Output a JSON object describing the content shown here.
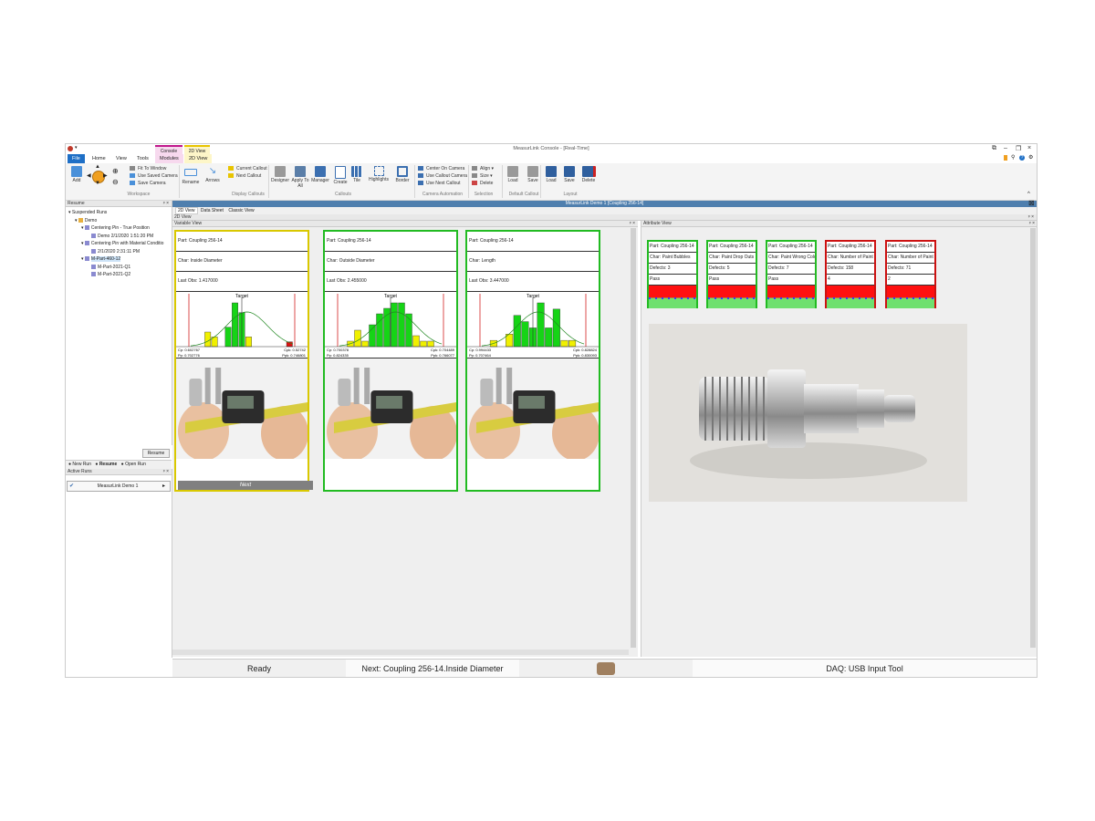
{
  "app": {
    "title": "MeasurLink Console - [Real-Time]",
    "context_tabs": [
      {
        "label": "Console",
        "color": "#c0188c"
      },
      {
        "label": "2D View",
        "color": "#e8c400"
      }
    ],
    "menu_tabs": [
      "File",
      "Home",
      "View",
      "Tools",
      "Modules",
      "2D View"
    ],
    "active_tab": "2D View"
  },
  "ribbon": {
    "workspace": {
      "group_label": "Workspace",
      "add_label": "Add",
      "small_items": [
        "Fit To Window",
        "Use Saved Camera",
        "Save Camera"
      ]
    },
    "display_callouts": {
      "group_label": "Display Callouts",
      "buttons": [
        "Rename",
        "Arrows"
      ],
      "small_items": [
        "Current Callout",
        "Next Callout"
      ]
    },
    "callouts": {
      "group_label": "Callouts",
      "buttons": [
        "Designer",
        "Apply To All",
        "Manager",
        "Create",
        "Tile",
        "Highlights",
        "Border"
      ]
    },
    "camera_automation": {
      "group_label": "Camera Automation",
      "small_items": [
        "Center On Camera",
        "Use Callout Camera",
        "Use Next Callout"
      ]
    },
    "selection": {
      "group_label": "Selection",
      "small_items": [
        "Align",
        "Size",
        "Delete"
      ]
    },
    "default_callout": {
      "group_label": "Default Callout",
      "buttons": [
        "Load",
        "Save"
      ]
    },
    "layout": {
      "group_label": "Layout",
      "buttons": [
        "Load",
        "Save",
        "Delete"
      ]
    }
  },
  "resume_pane": {
    "title": "Resume",
    "tree": [
      {
        "label": "Suspended Runs",
        "level": 0
      },
      {
        "label": "Demo",
        "level": 1
      },
      {
        "label": "Centering Pin - True Position",
        "level": 2
      },
      {
        "label": "Demo 2/1/2020 1:51:20 PM",
        "level": 3
      },
      {
        "label": "Centering Pin with Material Conditio",
        "level": 2
      },
      {
        "label": "2/1/2020 2:31:11 PM",
        "level": 3
      },
      {
        "label": "M-Part-460-12",
        "level": 1
      },
      {
        "label": "M-Part-2021-Q1",
        "level": 2
      },
      {
        "label": "M-Part-2021-Q2",
        "level": 2
      }
    ],
    "resume_button": "Resume",
    "bottom_tabs": [
      "New Run",
      "Resume",
      "Open Run"
    ],
    "active_runs_title": "Active Runs",
    "active_run": "MeasurLink Demo 1"
  },
  "document_tab": "MeasurLink Demo 1 [Coupling 256-14]",
  "view_tabs": [
    "2D View",
    "Data Sheet",
    "Classic View"
  ],
  "pane_2d_title": "2D View",
  "variable_view": {
    "title": "Variable View",
    "next_label": "Next",
    "cards": [
      {
        "part": "Part: Coupling 256-14",
        "char": "Char: Inside Diameter",
        "last_obs": "Last Obs: 1.417000",
        "border": "#d9c800",
        "bars": [
          0,
          0,
          3,
          2,
          0,
          4,
          9,
          7,
          2,
          0,
          0,
          0,
          0,
          0,
          1
        ],
        "bar_colors": [
          "y",
          "y",
          "y",
          "y",
          "y",
          "g",
          "g",
          "g",
          "y",
          "y",
          "y",
          "y",
          "y",
          "y",
          "r"
        ],
        "cp": "Cp: 0.602767",
        "cpk": "Cpk: 0.52742",
        "pp": "Pp: 0.702776",
        "ppk": "Ppk: 0.746801",
        "target": "Target"
      },
      {
        "part": "Part: Coupling 256-14",
        "char": "Char: Outside Diameter",
        "last_obs": "Last Obs: 2.455000",
        "border": "#22bb22",
        "bars": [
          0,
          1,
          3,
          1,
          4,
          6,
          7,
          8,
          8,
          6,
          2,
          1,
          1,
          0
        ],
        "bar_colors": [
          "y",
          "y",
          "y",
          "y",
          "g",
          "g",
          "g",
          "g",
          "g",
          "g",
          "y",
          "y",
          "y",
          "y"
        ],
        "cp": "Cp: 0.700378",
        "cpk": "Cpk: 0.704489",
        "pp": "Pp: 0.824335",
        "ppk": "Ppk: 0.766077",
        "target": "Target"
      },
      {
        "part": "Part: Coupling 256-14",
        "char": "Char: Length",
        "last_obs": "Last Obs: 3.447000",
        "border": "#22bb22",
        "bars": [
          0,
          1,
          0,
          2,
          5,
          4,
          3,
          7,
          3,
          6,
          1,
          1,
          0
        ],
        "bar_colors": [
          "r",
          "y",
          "y",
          "y",
          "g",
          "g",
          "g",
          "g",
          "g",
          "g",
          "y",
          "y",
          "y"
        ],
        "cp": "Cp: 0.994433",
        "cpk": "Cpk: 0.828824",
        "pp": "Pp: 0.707464",
        "ppk": "Ppk: 0.830093",
        "target": "Target"
      }
    ]
  },
  "attribute_view": {
    "title": "Attribute View",
    "cards": [
      {
        "part": "Part: Coupling 256-14",
        "char": "Char: Paint Bubbles",
        "defects": "Defects: 3",
        "result": "Pass",
        "border": "#22bb22"
      },
      {
        "part": "Part: Coupling 256-14",
        "char": "Char: Paint Drop Outs",
        "defects": "Defects: 5",
        "result": "Pass",
        "border": "#22bb22"
      },
      {
        "part": "Part: Coupling 256-14",
        "char": "Char: Paint Wrong Color",
        "defects": "Defects: 7",
        "result": "Pass",
        "border": "#22bb22"
      },
      {
        "part": "Part: Coupling 256-14",
        "char": "Char: Number of Paint D",
        "defects": "Defects: 158",
        "result": "4",
        "border": "#cc1111"
      },
      {
        "part": "Part: Coupling 256-14",
        "char": "Char: Number of Paint S",
        "defects": "Defects: 71",
        "result": "2",
        "border": "#cc1111"
      }
    ]
  },
  "status_bar": {
    "ready": "Ready",
    "next": "Next: Coupling 256-14.Inside Diameter",
    "daq": "DAQ: USB Input Tool"
  }
}
